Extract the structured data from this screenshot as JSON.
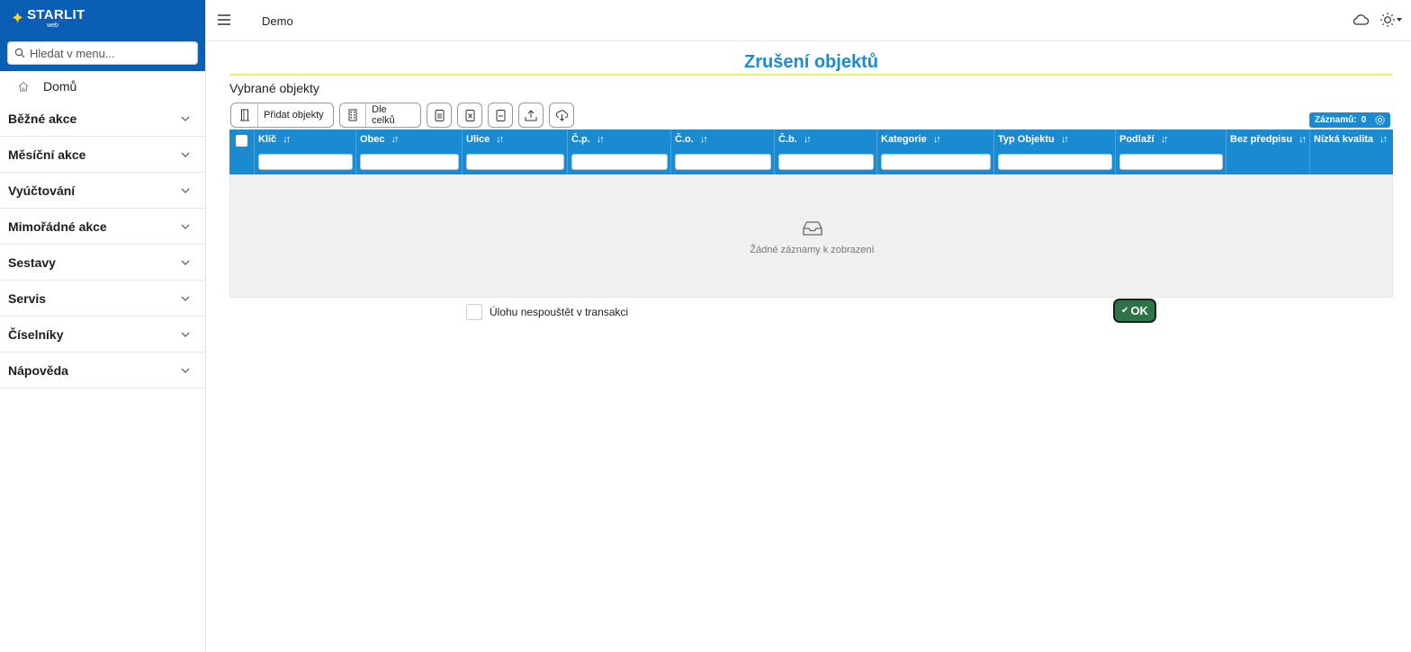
{
  "brand": {
    "name": "STARLIT",
    "sub": "web"
  },
  "sidebar": {
    "search_placeholder": "Hledat v menu...",
    "home_label": "Domů",
    "items": [
      {
        "label": "Běžné akce"
      },
      {
        "label": "Měsíční akce"
      },
      {
        "label": "Vyúčtování"
      },
      {
        "label": "Mimořádné akce"
      },
      {
        "label": "Sestavy"
      },
      {
        "label": "Servis"
      },
      {
        "label": "Číselníky"
      },
      {
        "label": "Nápověda"
      }
    ]
  },
  "topbar": {
    "title": "Demo"
  },
  "main": {
    "page_title": "Zrušení objektů",
    "section_label": "Vybrané objekty",
    "toolbar": {
      "add_label": "Přidat objekty",
      "cells_label": "Dle celků"
    },
    "count_label": "Záznamů:",
    "count_value": "0",
    "columns": [
      {
        "label": "Klíč"
      },
      {
        "label": "Obec"
      },
      {
        "label": "Ulice"
      },
      {
        "label": "Č.p."
      },
      {
        "label": "Č.o."
      },
      {
        "label": "Č.b."
      },
      {
        "label": "Kategorie"
      },
      {
        "label": "Typ Objektu"
      },
      {
        "label": "Podlaží"
      },
      {
        "label": "Bez předpisu"
      },
      {
        "label": "Nízká kvalita"
      }
    ],
    "empty_text": "Žádné záznamy k zobrazení",
    "checkbox_label": "Úlohu nespouštět v transakci",
    "ok_label": "OK"
  },
  "colors": {
    "brand": "#0a5fb4",
    "accent": "#1a8bd0",
    "ok": "#2e7347",
    "title_underline": "#f4ee5e"
  }
}
